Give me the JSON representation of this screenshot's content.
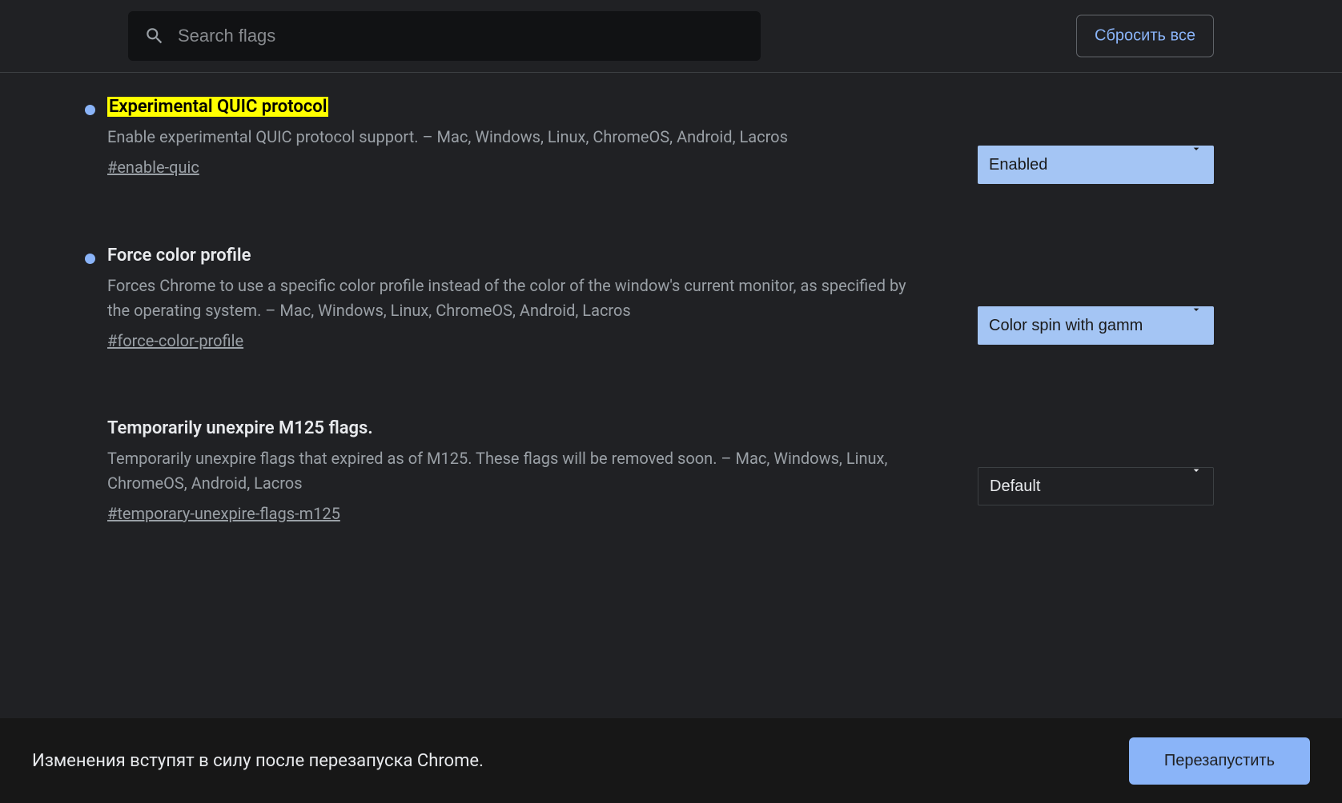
{
  "search": {
    "placeholder": "Search flags"
  },
  "reset_button": "Сбросить все",
  "flags": [
    {
      "title": "Experimental QUIC protocol",
      "highlighted": true,
      "has_dot": true,
      "description": "Enable experimental QUIC protocol support. – Mac, Windows, Linux, ChromeOS, Android, Lacros",
      "hash": "#enable-quic",
      "selected": "Enabled",
      "select_style": "enabled"
    },
    {
      "title": "Force color profile",
      "highlighted": false,
      "has_dot": true,
      "description": "Forces Chrome to use a specific color profile instead of the color of the window's current monitor, as specified by the operating system. – Mac, Windows, Linux, ChromeOS, Android, Lacros",
      "hash": "#force-color-profile",
      "selected": "Color spin with gamm",
      "select_style": "enabled"
    },
    {
      "title": "Temporarily unexpire M125 flags.",
      "highlighted": false,
      "has_dot": false,
      "description": "Temporarily unexpire flags that expired as of M125. These flags will be removed soon. – Mac, Windows, Linux, ChromeOS, Android, Lacros",
      "hash": "#temporary-unexpire-flags-m125",
      "selected": "Default",
      "select_style": "default"
    }
  ],
  "footer": {
    "message": "Изменения вступят в силу после перезапуска Chrome.",
    "restart": "Перезапустить"
  }
}
